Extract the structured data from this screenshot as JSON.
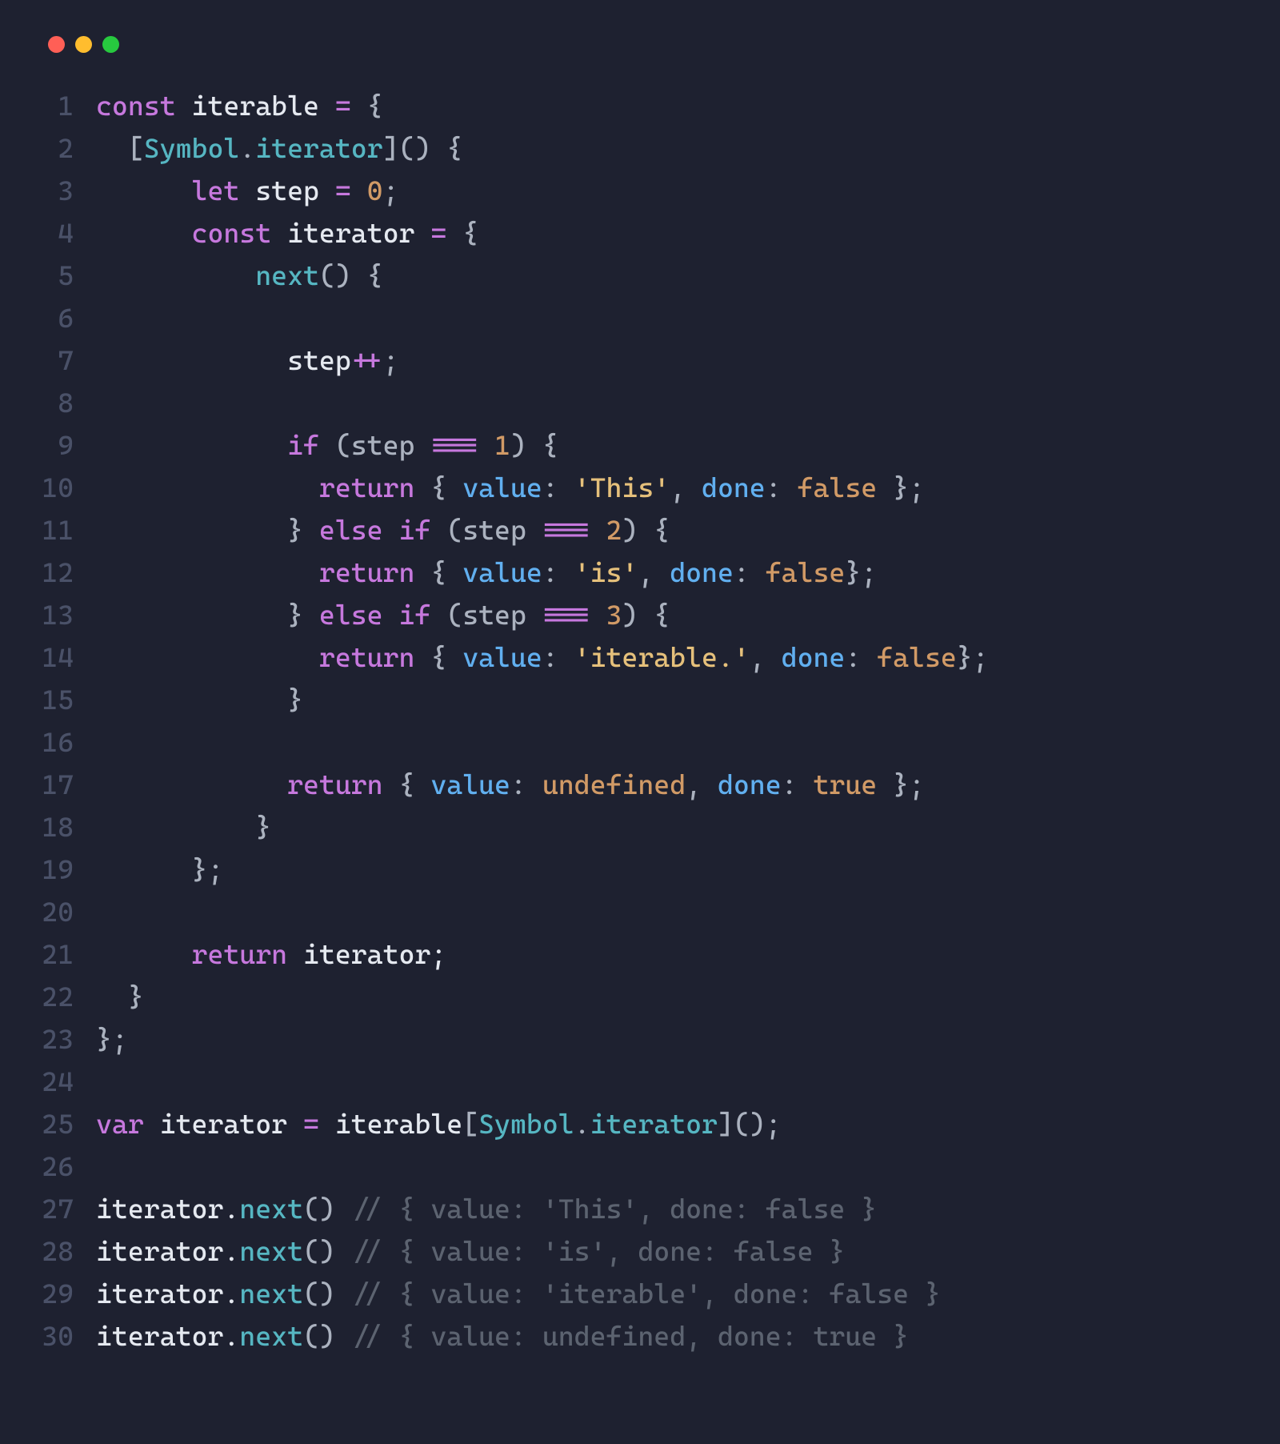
{
  "colors": {
    "bg": "#1e2130",
    "dot_red": "#ff5f56",
    "dot_yellow": "#ffbd2e",
    "dot_green": "#27c93f"
  },
  "lines": [
    {
      "n": "1",
      "tokens": [
        [
          "kw",
          "const"
        ],
        [
          "ident",
          " iterable "
        ],
        [
          "op",
          "="
        ],
        [
          "punct",
          " {"
        ]
      ]
    },
    {
      "n": "2",
      "tokens": [
        [
          "ident",
          "  "
        ],
        [
          "punct",
          "["
        ],
        [
          "builtin",
          "Symbol"
        ],
        [
          "punct",
          "."
        ],
        [
          "fn",
          "iterator"
        ],
        [
          "punct",
          "]() {"
        ]
      ]
    },
    {
      "n": "3",
      "tokens": [
        [
          "ident",
          "      "
        ],
        [
          "kw",
          "let"
        ],
        [
          "ident",
          " step "
        ],
        [
          "op",
          "="
        ],
        [
          "ident",
          " "
        ],
        [
          "num",
          "0"
        ],
        [
          "punct",
          ";"
        ]
      ]
    },
    {
      "n": "4",
      "tokens": [
        [
          "ident",
          "      "
        ],
        [
          "kw",
          "const"
        ],
        [
          "ident",
          " iterator "
        ],
        [
          "op",
          "="
        ],
        [
          "punct",
          " {"
        ]
      ]
    },
    {
      "n": "5",
      "tokens": [
        [
          "ident",
          "          "
        ],
        [
          "fn",
          "next"
        ],
        [
          "punct",
          "() {"
        ]
      ]
    },
    {
      "n": "6",
      "tokens": [
        [
          "ident",
          ""
        ]
      ]
    },
    {
      "n": "7",
      "tokens": [
        [
          "ident",
          "            step"
        ],
        [
          "op",
          "++"
        ],
        [
          "punct",
          ";"
        ]
      ]
    },
    {
      "n": "8",
      "tokens": [
        [
          "ident",
          ""
        ]
      ]
    },
    {
      "n": "9",
      "tokens": [
        [
          "ident",
          "            "
        ],
        [
          "kw",
          "if"
        ],
        [
          "punct",
          " (step "
        ],
        [
          "op",
          "==="
        ],
        [
          "ident",
          " "
        ],
        [
          "num",
          "1"
        ],
        [
          "punct",
          ") {"
        ]
      ]
    },
    {
      "n": "10",
      "tokens": [
        [
          "ident",
          "              "
        ],
        [
          "kw",
          "return"
        ],
        [
          "punct",
          " { "
        ],
        [
          "prop",
          "value"
        ],
        [
          "punct",
          ": "
        ],
        [
          "str",
          "'This'"
        ],
        [
          "punct",
          ", "
        ],
        [
          "prop",
          "done"
        ],
        [
          "punct",
          ": "
        ],
        [
          "const",
          "false"
        ],
        [
          "punct",
          " };"
        ]
      ]
    },
    {
      "n": "11",
      "tokens": [
        [
          "ident",
          "            "
        ],
        [
          "punct",
          "} "
        ],
        [
          "kw",
          "else if"
        ],
        [
          "punct",
          " (step "
        ],
        [
          "op",
          "==="
        ],
        [
          "ident",
          " "
        ],
        [
          "num",
          "2"
        ],
        [
          "punct",
          ") {"
        ]
      ]
    },
    {
      "n": "12",
      "tokens": [
        [
          "ident",
          "              "
        ],
        [
          "kw",
          "return"
        ],
        [
          "punct",
          " { "
        ],
        [
          "prop",
          "value"
        ],
        [
          "punct",
          ": "
        ],
        [
          "str",
          "'is'"
        ],
        [
          "punct",
          ", "
        ],
        [
          "prop",
          "done"
        ],
        [
          "punct",
          ": "
        ],
        [
          "const",
          "false"
        ],
        [
          "punct",
          "};"
        ]
      ]
    },
    {
      "n": "13",
      "tokens": [
        [
          "ident",
          "            "
        ],
        [
          "punct",
          "} "
        ],
        [
          "kw",
          "else if"
        ],
        [
          "punct",
          " (step "
        ],
        [
          "op",
          "==="
        ],
        [
          "ident",
          " "
        ],
        [
          "num",
          "3"
        ],
        [
          "punct",
          ") {"
        ]
      ]
    },
    {
      "n": "14",
      "tokens": [
        [
          "ident",
          "              "
        ],
        [
          "kw",
          "return"
        ],
        [
          "punct",
          " { "
        ],
        [
          "prop",
          "value"
        ],
        [
          "punct",
          ": "
        ],
        [
          "str",
          "'iterable.'"
        ],
        [
          "punct",
          ", "
        ],
        [
          "prop",
          "done"
        ],
        [
          "punct",
          ": "
        ],
        [
          "const",
          "false"
        ],
        [
          "punct",
          "};"
        ]
      ]
    },
    {
      "n": "15",
      "tokens": [
        [
          "ident",
          "            "
        ],
        [
          "punct",
          "}"
        ]
      ]
    },
    {
      "n": "16",
      "tokens": [
        [
          "ident",
          ""
        ]
      ]
    },
    {
      "n": "17",
      "tokens": [
        [
          "ident",
          "            "
        ],
        [
          "kw",
          "return"
        ],
        [
          "punct",
          " { "
        ],
        [
          "prop",
          "value"
        ],
        [
          "punct",
          ": "
        ],
        [
          "const",
          "undefined"
        ],
        [
          "punct",
          ", "
        ],
        [
          "prop",
          "done"
        ],
        [
          "punct",
          ": "
        ],
        [
          "const",
          "true"
        ],
        [
          "punct",
          " };"
        ]
      ]
    },
    {
      "n": "18",
      "tokens": [
        [
          "ident",
          "          "
        ],
        [
          "punct",
          "}"
        ]
      ]
    },
    {
      "n": "19",
      "tokens": [
        [
          "ident",
          "      "
        ],
        [
          "punct",
          "};"
        ]
      ]
    },
    {
      "n": "20",
      "tokens": [
        [
          "ident",
          ""
        ]
      ]
    },
    {
      "n": "21",
      "tokens": [
        [
          "ident",
          "      "
        ],
        [
          "kw",
          "return"
        ],
        [
          "ident",
          " iterator;"
        ]
      ]
    },
    {
      "n": "22",
      "tokens": [
        [
          "ident",
          "  "
        ],
        [
          "punct",
          "}"
        ]
      ]
    },
    {
      "n": "23",
      "tokens": [
        [
          "punct",
          "};"
        ]
      ]
    },
    {
      "n": "24",
      "tokens": [
        [
          "ident",
          ""
        ]
      ]
    },
    {
      "n": "25",
      "tokens": [
        [
          "kw",
          "var"
        ],
        [
          "ident",
          " iterator "
        ],
        [
          "op",
          "="
        ],
        [
          "ident",
          " iterable"
        ],
        [
          "punct",
          "["
        ],
        [
          "builtin",
          "Symbol"
        ],
        [
          "punct",
          "."
        ],
        [
          "fn",
          "iterator"
        ],
        [
          "punct",
          "]();"
        ]
      ]
    },
    {
      "n": "26",
      "tokens": [
        [
          "ident",
          ""
        ]
      ]
    },
    {
      "n": "27",
      "tokens": [
        [
          "ident",
          "iterator."
        ],
        [
          "fn",
          "next"
        ],
        [
          "punct",
          "() "
        ],
        [
          "cmt",
          "// { value: 'This', done: false }"
        ]
      ]
    },
    {
      "n": "28",
      "tokens": [
        [
          "ident",
          "iterator."
        ],
        [
          "fn",
          "next"
        ],
        [
          "punct",
          "() "
        ],
        [
          "cmt",
          "// { value: 'is', done: false }"
        ]
      ]
    },
    {
      "n": "29",
      "tokens": [
        [
          "ident",
          "iterator."
        ],
        [
          "fn",
          "next"
        ],
        [
          "punct",
          "() "
        ],
        [
          "cmt",
          "// { value: 'iterable', done: false }"
        ]
      ]
    },
    {
      "n": "30",
      "tokens": [
        [
          "ident",
          "iterator."
        ],
        [
          "fn",
          "next"
        ],
        [
          "punct",
          "() "
        ],
        [
          "cmt",
          "// { value: undefined, done: true }"
        ]
      ]
    }
  ]
}
